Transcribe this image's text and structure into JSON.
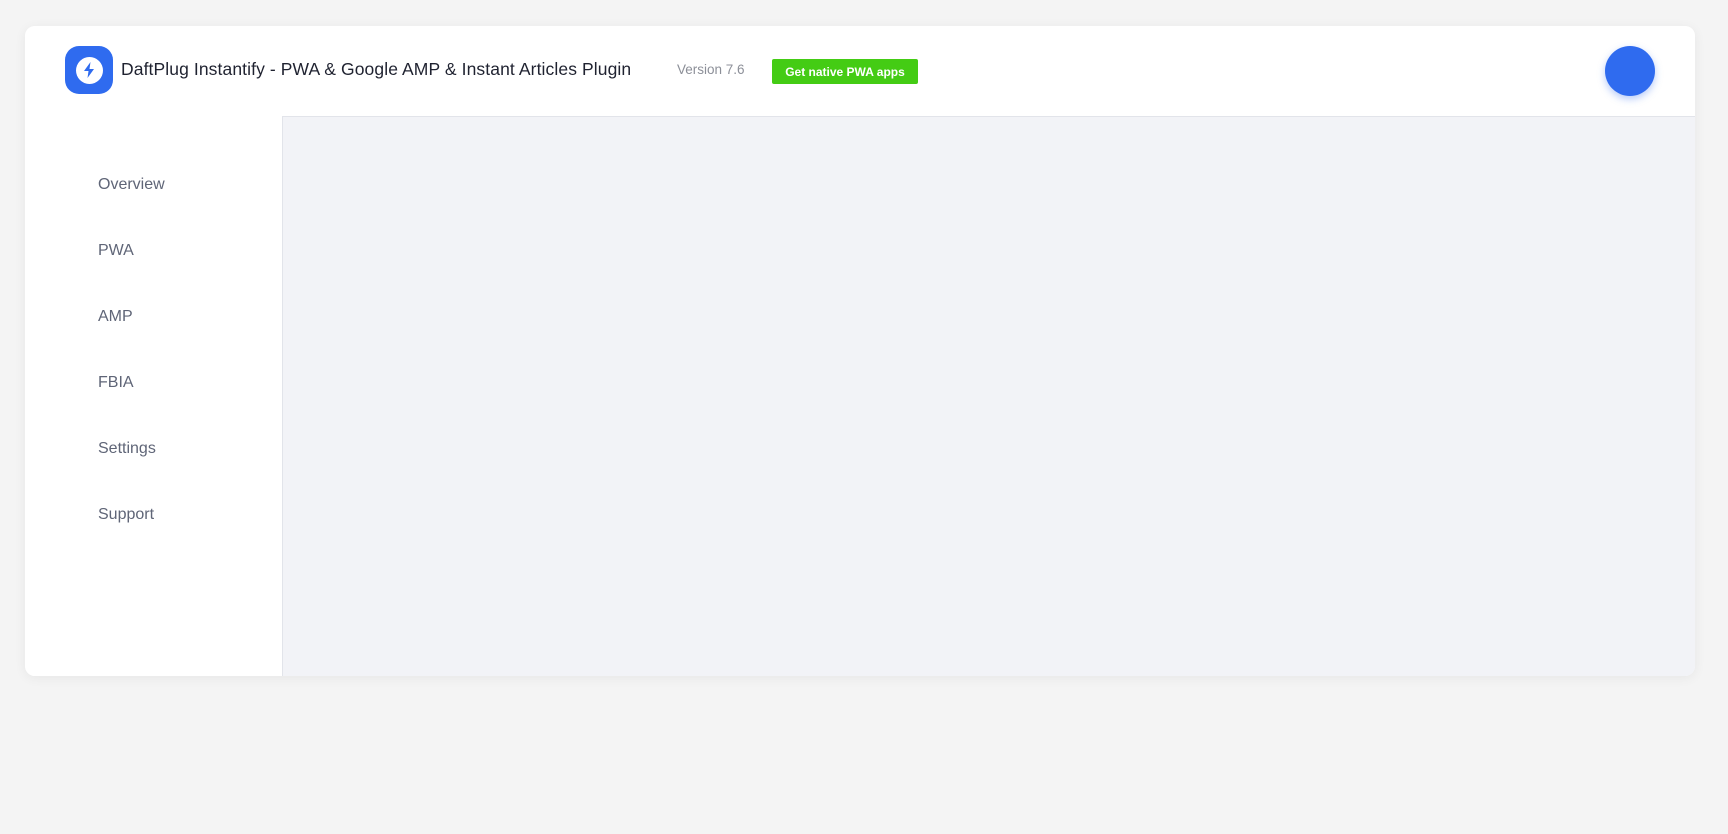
{
  "header": {
    "logo_icon": "lightning-bolt-icon",
    "title": "DaftPlug Instantify - PWA & Google AMP & Instant Articles Plugin",
    "version": "Version 7.6",
    "pwa_button_label": "Get native PWA apps"
  },
  "sidebar": {
    "items": [
      {
        "label": "Overview"
      },
      {
        "label": "PWA"
      },
      {
        "label": "AMP"
      },
      {
        "label": "FBIA"
      },
      {
        "label": "Settings"
      },
      {
        "label": "Support"
      }
    ]
  },
  "colors": {
    "brand_blue": "#2f6bef",
    "button_green": "#44cc14",
    "page_background": "#f4f4f4",
    "content_background": "#f2f3f7",
    "nav_text": "#5f6577"
  }
}
